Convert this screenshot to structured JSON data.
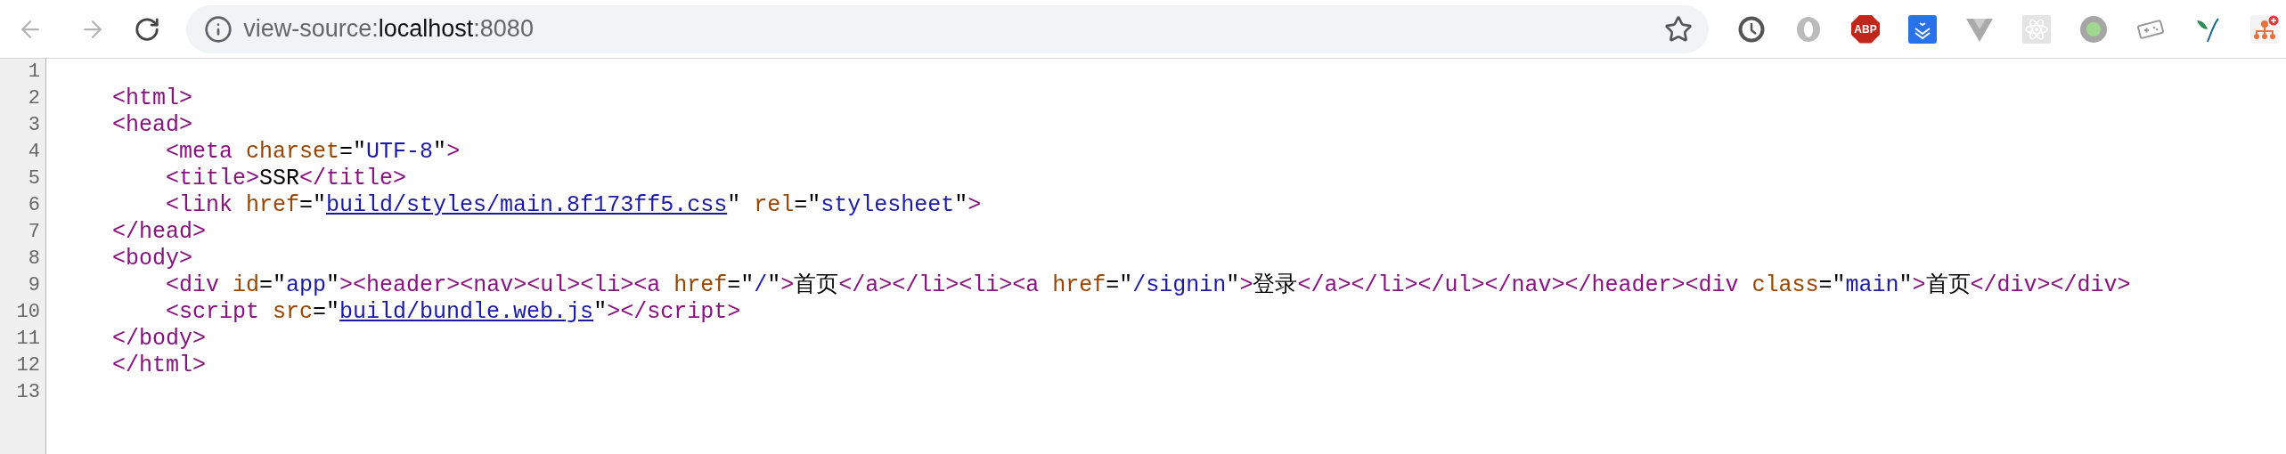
{
  "toolbar": {
    "back": {
      "disabled": true
    },
    "forward": {
      "disabled": true
    },
    "address": {
      "prefix": "view-source:",
      "host": "localhost",
      "suffix": ":8080"
    },
    "extensions": [
      {
        "kind": "clock"
      },
      {
        "kind": "ring"
      },
      {
        "kind": "abp",
        "label": "ABP"
      },
      {
        "kind": "download"
      },
      {
        "kind": "vee"
      },
      {
        "kind": "atom"
      },
      {
        "kind": "dot"
      },
      {
        "kind": "gamepad"
      },
      {
        "kind": "feather"
      },
      {
        "kind": "tree"
      }
    ]
  },
  "source": {
    "lines": [
      {
        "number": "1"
      },
      {
        "number": "2",
        "tokens": [
          {
            "kind": "tag",
            "text": "    <html>"
          }
        ]
      },
      {
        "number": "3",
        "tokens": [
          {
            "kind": "tag",
            "text": "    <head>"
          }
        ]
      },
      {
        "number": "4",
        "tokens": [
          {
            "kind": "tag",
            "text": "        <meta "
          },
          {
            "kind": "attr",
            "text": "charset"
          },
          {
            "kind": "plain",
            "text": "=\""
          },
          {
            "kind": "value",
            "text": "UTF-8"
          },
          {
            "kind": "plain",
            "text": "\""
          },
          {
            "kind": "tag",
            "text": ">"
          }
        ]
      },
      {
        "number": "5",
        "tokens": [
          {
            "kind": "tag",
            "text": "        <title>"
          },
          {
            "kind": "plain",
            "text": "SSR"
          },
          {
            "kind": "tag",
            "text": "</title>"
          }
        ]
      },
      {
        "number": "6",
        "tokens": [
          {
            "kind": "tag",
            "text": "        <link "
          },
          {
            "kind": "attr",
            "text": "href"
          },
          {
            "kind": "plain",
            "text": "=\""
          },
          {
            "kind": "link",
            "text": "build/styles/main.8f173ff5.css"
          },
          {
            "kind": "plain",
            "text": "\" "
          },
          {
            "kind": "attr",
            "text": "rel"
          },
          {
            "kind": "plain",
            "text": "=\""
          },
          {
            "kind": "value",
            "text": "stylesheet"
          },
          {
            "kind": "plain",
            "text": "\""
          },
          {
            "kind": "tag",
            "text": ">"
          }
        ]
      },
      {
        "number": "7",
        "tokens": [
          {
            "kind": "tag",
            "text": "    </head>"
          }
        ]
      },
      {
        "number": "8",
        "tokens": [
          {
            "kind": "tag",
            "text": "    <body>"
          }
        ]
      },
      {
        "number": "9",
        "tokens": [
          {
            "kind": "tag",
            "text": "        <div "
          },
          {
            "kind": "attr",
            "text": "id"
          },
          {
            "kind": "plain",
            "text": "=\""
          },
          {
            "kind": "value",
            "text": "app"
          },
          {
            "kind": "plain",
            "text": "\""
          },
          {
            "kind": "tag",
            "text": "><header><nav><ul><li><a "
          },
          {
            "kind": "attr",
            "text": "href"
          },
          {
            "kind": "plain",
            "text": "=\""
          },
          {
            "kind": "value",
            "text": "/"
          },
          {
            "kind": "plain",
            "text": "\""
          },
          {
            "kind": "tag",
            "text": ">"
          },
          {
            "kind": "plain",
            "text": "首页"
          },
          {
            "kind": "tag",
            "text": "</a></li><li><a "
          },
          {
            "kind": "attr",
            "text": "href"
          },
          {
            "kind": "plain",
            "text": "=\""
          },
          {
            "kind": "value",
            "text": "/signin"
          },
          {
            "kind": "plain",
            "text": "\""
          },
          {
            "kind": "tag",
            "text": ">"
          },
          {
            "kind": "plain",
            "text": "登录"
          },
          {
            "kind": "tag",
            "text": "</a></li></ul></nav></header><div "
          },
          {
            "kind": "attr",
            "text": "class"
          },
          {
            "kind": "plain",
            "text": "=\""
          },
          {
            "kind": "value",
            "text": "main"
          },
          {
            "kind": "plain",
            "text": "\""
          },
          {
            "kind": "tag",
            "text": ">"
          },
          {
            "kind": "plain",
            "text": "首页"
          },
          {
            "kind": "tag",
            "text": "</div></div>"
          }
        ]
      },
      {
        "number": "10",
        "tokens": [
          {
            "kind": "tag",
            "text": "        <script "
          },
          {
            "kind": "attr",
            "text": "src"
          },
          {
            "kind": "plain",
            "text": "=\""
          },
          {
            "kind": "link",
            "text": "build/bundle.web.js"
          },
          {
            "kind": "plain",
            "text": "\""
          },
          {
            "kind": "tag",
            "text": "></script>"
          }
        ]
      },
      {
        "number": "11",
        "tokens": [
          {
            "kind": "tag",
            "text": "    </body>"
          }
        ]
      },
      {
        "number": "12",
        "tokens": [
          {
            "kind": "tag",
            "text": "    </html>"
          }
        ]
      },
      {
        "number": "13"
      }
    ]
  }
}
